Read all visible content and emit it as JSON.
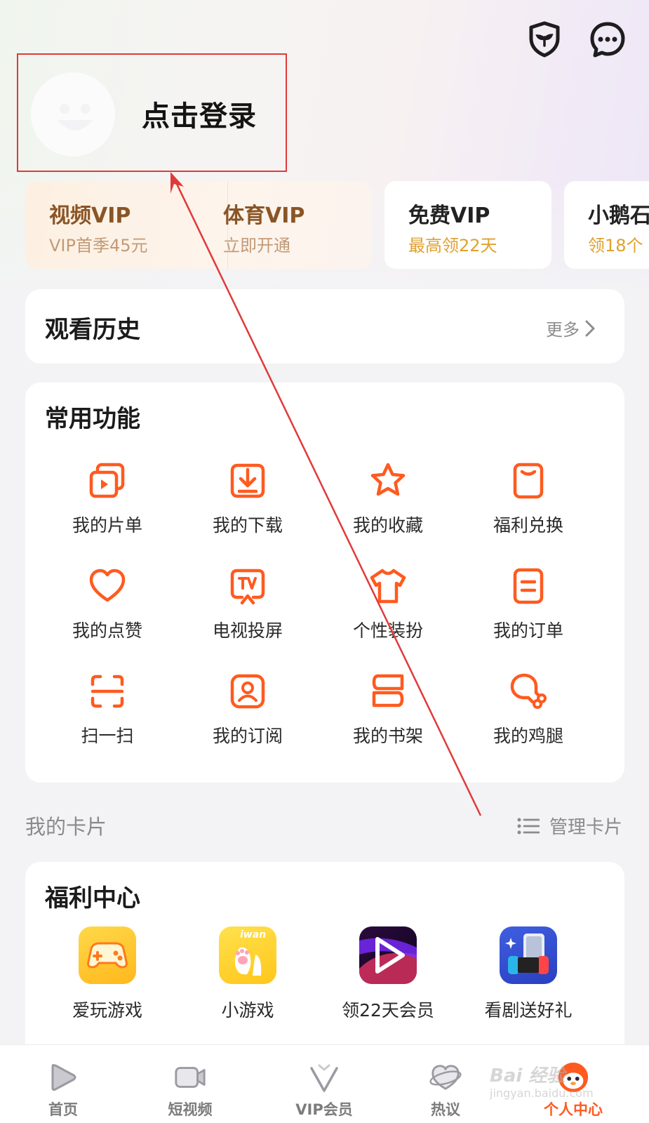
{
  "header": {
    "login_text": "点击登录"
  },
  "vip_cards": [
    {
      "title": "视频VIP",
      "subtitle": "VIP首季45元"
    },
    {
      "title": "体育VIP",
      "subtitle": "立即开通"
    },
    {
      "title": "免费VIP",
      "subtitle": "最高领22天"
    },
    {
      "title": "小鹅石",
      "subtitle": "领18个"
    }
  ],
  "history": {
    "title": "观看历史",
    "more_label": "更多"
  },
  "functions": {
    "title": "常用功能",
    "items": [
      {
        "label": "我的片单",
        "icon": "playlist-icon"
      },
      {
        "label": "我的下载",
        "icon": "download-icon"
      },
      {
        "label": "我的收藏",
        "icon": "star-icon"
      },
      {
        "label": "福利兑换",
        "icon": "coupon-icon"
      },
      {
        "label": "我的点赞",
        "icon": "heart-icon"
      },
      {
        "label": "电视投屏",
        "icon": "tv-cast-icon"
      },
      {
        "label": "个性装扮",
        "icon": "tshirt-icon"
      },
      {
        "label": "我的订单",
        "icon": "order-icon"
      },
      {
        "label": "扫一扫",
        "icon": "scan-icon"
      },
      {
        "label": "我的订阅",
        "icon": "subscribe-icon"
      },
      {
        "label": "我的书架",
        "icon": "bookshelf-icon"
      },
      {
        "label": "我的鸡腿",
        "icon": "drumstick-icon"
      }
    ]
  },
  "my_cards": {
    "label": "我的卡片",
    "manage_label": "管理卡片"
  },
  "welfare": {
    "title": "福利中心",
    "items": [
      {
        "label": "爱玩游戏",
        "icon": "gamepad-app-icon"
      },
      {
        "label": "小游戏",
        "icon": "iwan-app-icon"
      },
      {
        "label": "领22天会员",
        "icon": "video-app-icon"
      },
      {
        "label": "看剧送好礼",
        "icon": "gift-app-icon"
      }
    ],
    "iwan_text": "iwan"
  },
  "bottom_nav": [
    {
      "label": "首页",
      "icon": "home-icon"
    },
    {
      "label": "短视频",
      "icon": "short-video-icon"
    },
    {
      "label": "VIP会员",
      "icon": "vip-icon"
    },
    {
      "label": "热议",
      "icon": "discussion-icon"
    },
    {
      "label": "个人中心",
      "icon": "profile-icon"
    }
  ],
  "watermark": {
    "text": "Bai 经验",
    "sub": "jingyan.baidu.com"
  },
  "colors": {
    "accent": "#ff5a1f",
    "annotation": "#e03a3a",
    "gold_text": "#8a5526"
  }
}
